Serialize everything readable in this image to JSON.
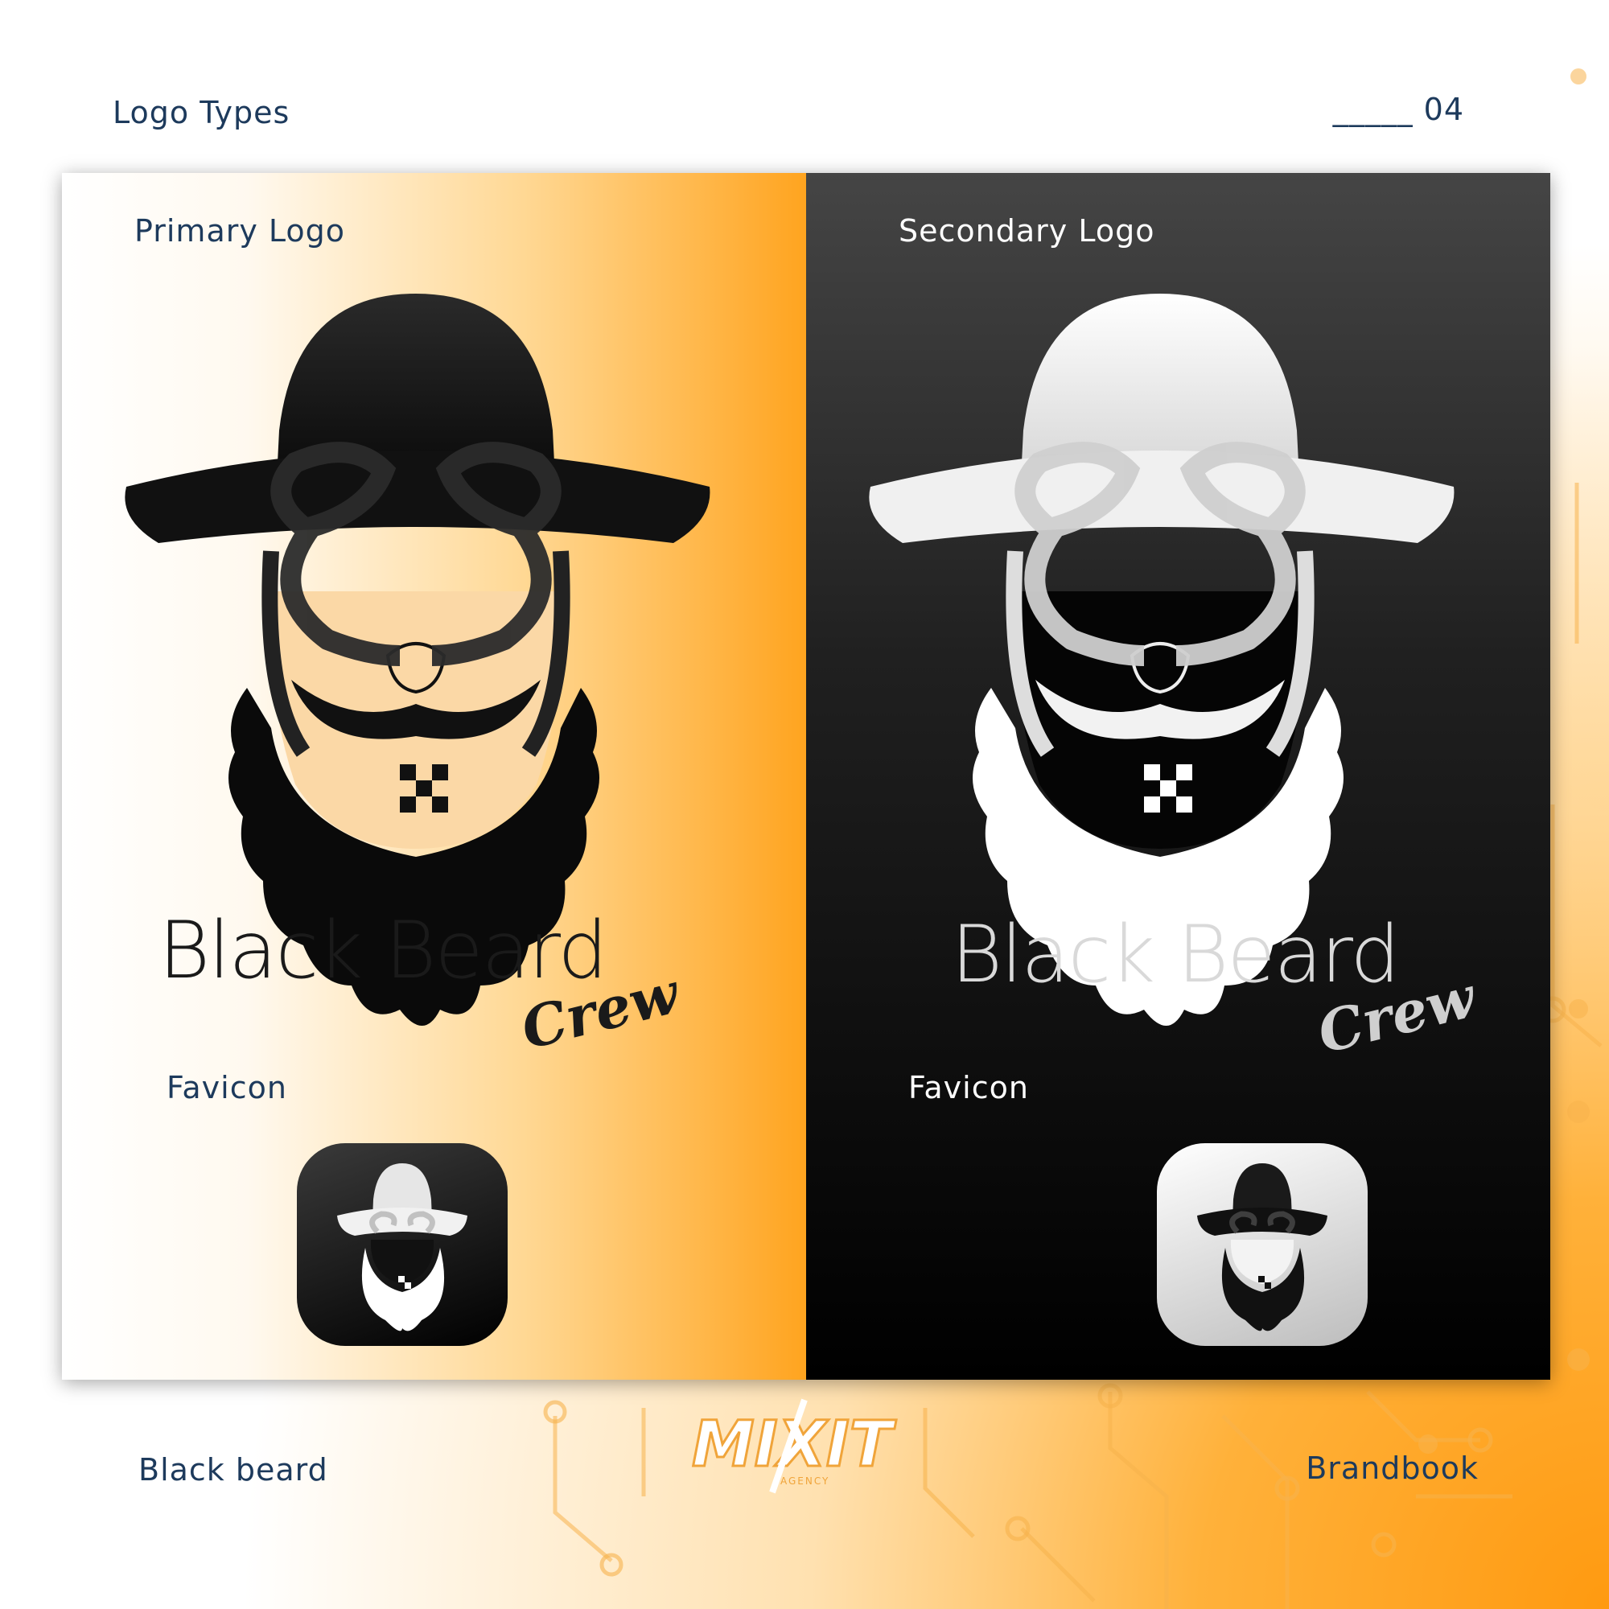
{
  "header": {
    "section_title": "Logo Types",
    "page_number": "_____ 04"
  },
  "panels": {
    "primary": {
      "label": "Primary Logo",
      "wordmark": "Black Beard",
      "wordmark_sub": "Crew",
      "favicon_label": "Favicon"
    },
    "secondary": {
      "label": "Secondary Logo",
      "wordmark": "Black Beard",
      "wordmark_sub": "Crew",
      "favicon_label": "Favicon"
    }
  },
  "footer": {
    "left": "Black beard",
    "right": "Brandbook",
    "agency_logo": "MIXIT",
    "agency_sub": "AGENCY"
  },
  "colors": {
    "accent": "#ffa41f",
    "text": "#1d3a5c",
    "dark": "#000000"
  }
}
